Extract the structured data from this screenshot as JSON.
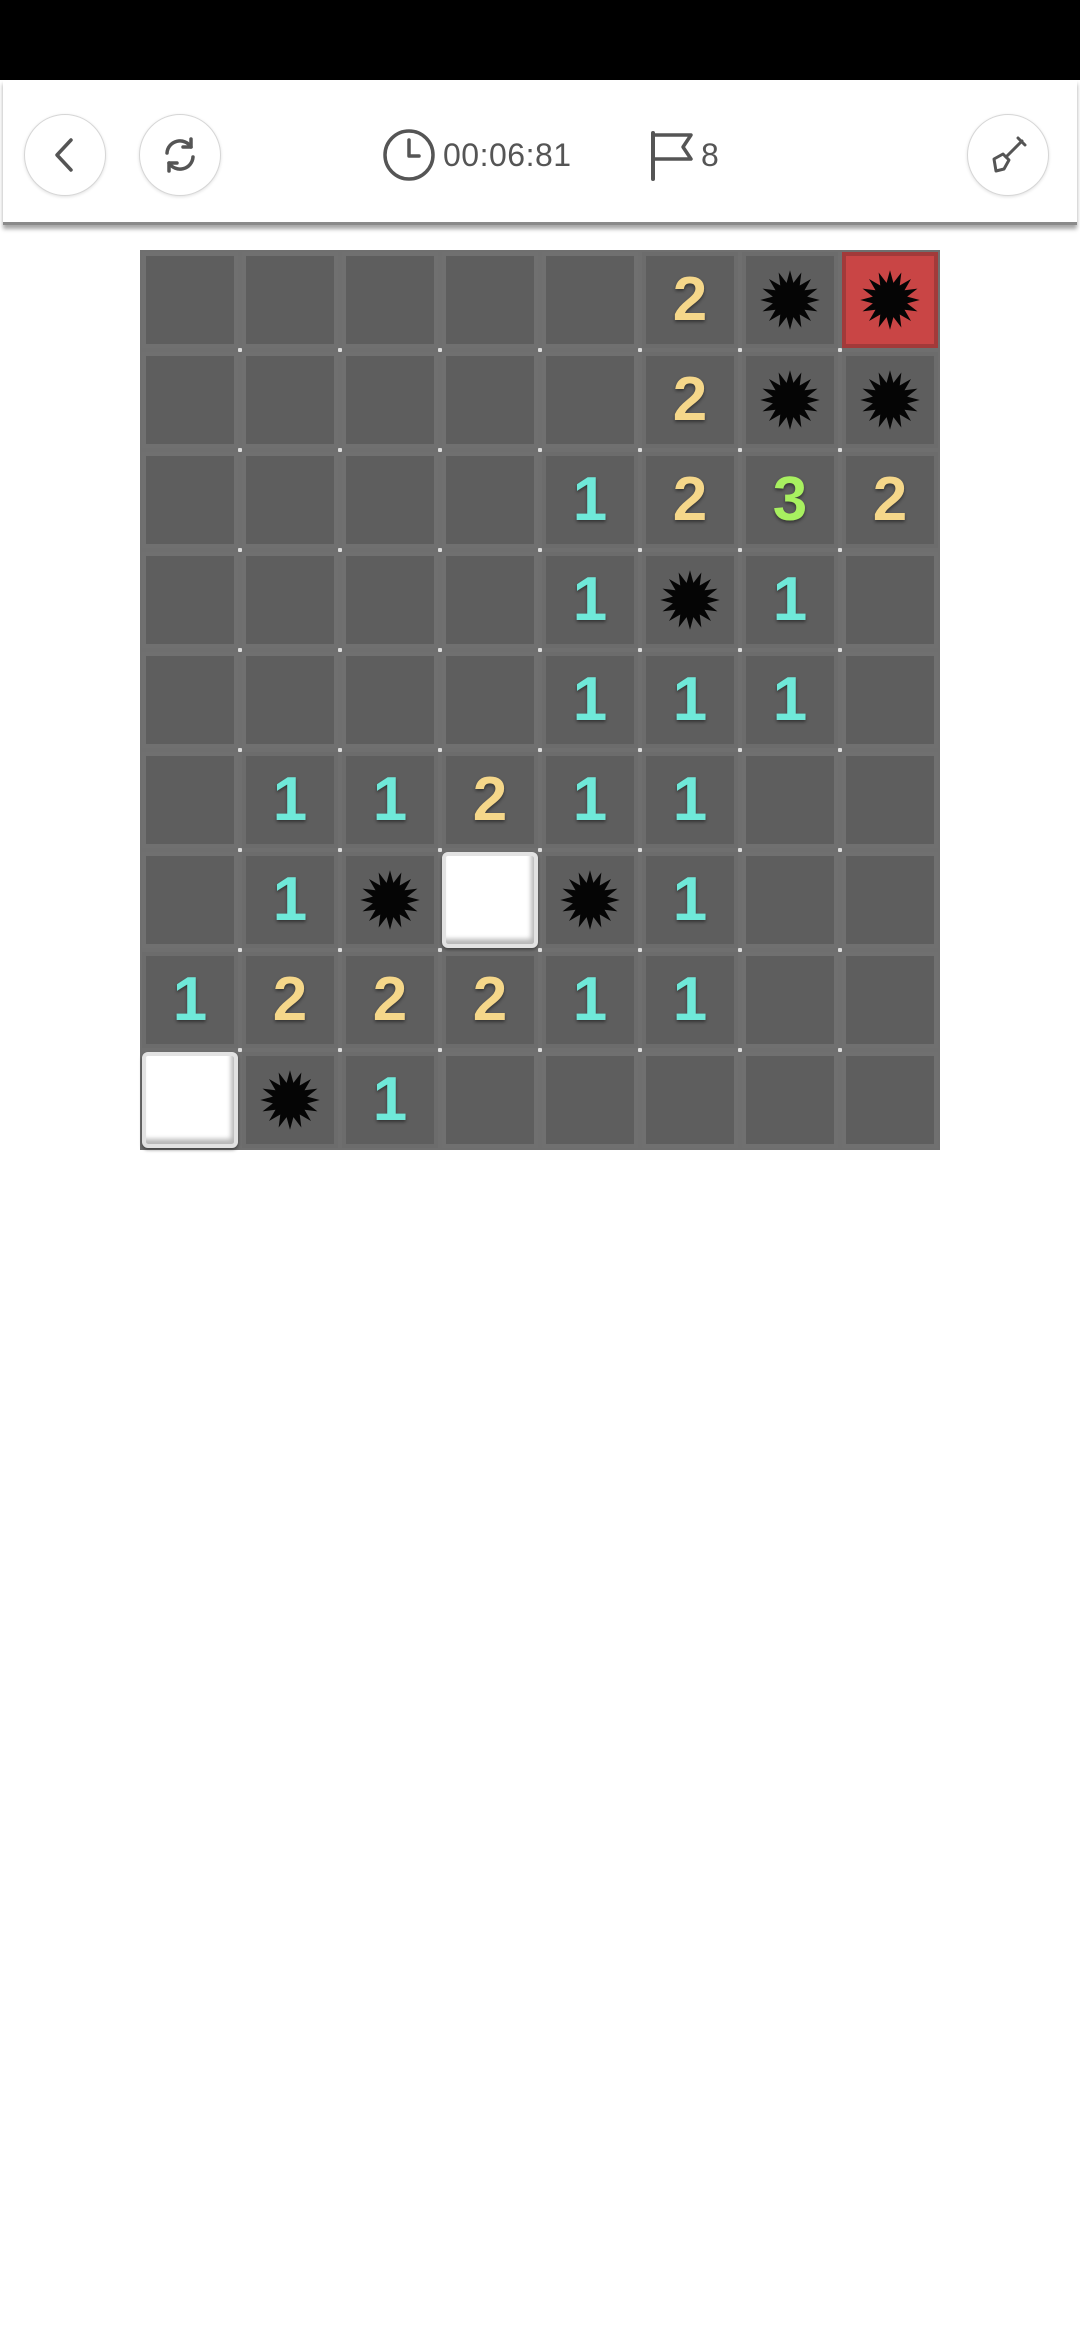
{
  "header": {
    "timer": "00:06:81",
    "flags": "8"
  },
  "icons": {
    "back": "chevron-left-icon",
    "restart": "refresh-icon",
    "clock": "clock-icon",
    "flag": "flag-icon",
    "mode": "shovel-icon"
  },
  "colors": {
    "one": "#6fe9d9",
    "two": "#f5d78a",
    "three": "#a8f060",
    "cell": "#5e5e5e",
    "grid": "#707070",
    "exploded": "#c94545"
  },
  "board": {
    "rows": 9,
    "cols": 8,
    "cells": [
      [
        "",
        "",
        "",
        "",
        "",
        "2",
        "M",
        "X"
      ],
      [
        "",
        "",
        "",
        "",
        "",
        "2",
        "M",
        "M"
      ],
      [
        "",
        "",
        "",
        "",
        "1",
        "2",
        "3",
        "2"
      ],
      [
        "",
        "",
        "",
        "",
        "1",
        "M",
        "1",
        ""
      ],
      [
        "",
        "",
        "",
        "",
        "1",
        "1",
        "1",
        ""
      ],
      [
        "",
        "1",
        "1",
        "2",
        "1",
        "1",
        "",
        ""
      ],
      [
        "",
        "1",
        "M",
        "W",
        "M",
        "1",
        "",
        ""
      ],
      [
        "1",
        "2",
        "2",
        "2",
        "1",
        "1",
        "",
        ""
      ],
      [
        "W",
        "M",
        "1",
        "",
        "",
        "",
        "",
        ""
      ]
    ]
  }
}
